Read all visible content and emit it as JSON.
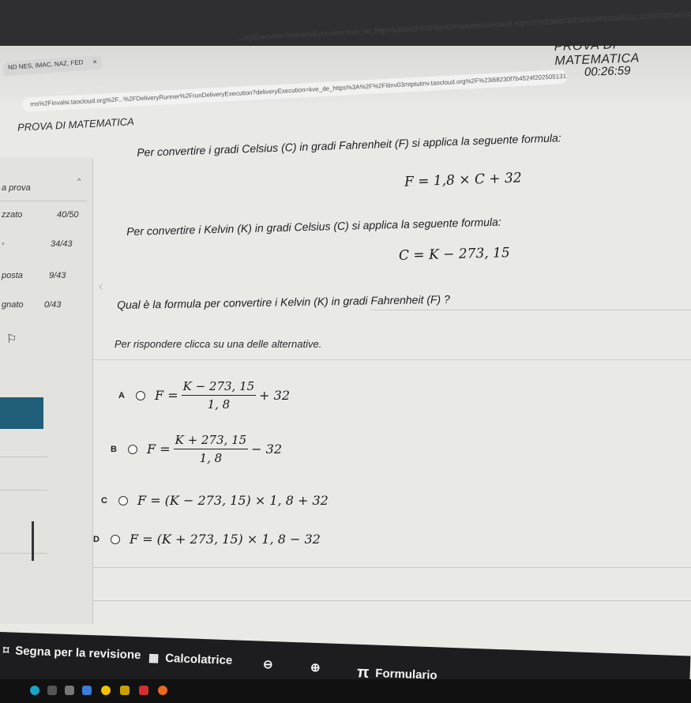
{
  "browser": {
    "tab_title": "ND NES, IMAC, NAZ, FED",
    "tab_close": "×",
    "url_text": "ms%2Finvalsi.taocloud.org%2F...%2FDeliveryRunner%2FrunDeliveryExecution?deliveryExecution=kve_de_https%3A%2F%2Fitinv03mtptutinv.taocloud.org%2F%23i68230f7b4524f2025051311230",
    "url_top": "...eryExecution?deliveryExecution=kve_de_https%3A%2F%2Fitinv03mtptutinv.taocloud.org%2F%23i68230f7b4524f202505131 12307d110eb14"
  },
  "header": {
    "title": "PROVA DI MATEMATICA",
    "timer": "00:26:59"
  },
  "sidebar": {
    "title": "PROVA DI MATEMATICA",
    "items": [
      {
        "label": "a prova",
        "value": ""
      },
      {
        "label": "zzato",
        "value": "40/50"
      },
      {
        "label": "",
        "value": "34/43"
      },
      {
        "label": "posta",
        "value": "9/43"
      },
      {
        "label": "gnato",
        "value": "0/43"
      }
    ]
  },
  "question": {
    "intro1": "Per convertire i gradi Celsius (C) in gradi Fahrenheit (F) si applica la seguente formula:",
    "formula1": "F = 1,8 × C + 32",
    "intro2": "Per convertire i Kelvin (K) in gradi Celsius (C) si applica la seguente formula:",
    "formula2": "C = K − 273, 15",
    "prompt": "Qual è la formula per convertire i Kelvin (K) in gradi Fahrenheit (F) ?",
    "instruction": "Per rispondere clicca su una delle alternative."
  },
  "options": {
    "a": {
      "letter": "A",
      "lhs": "F =",
      "num": "K − 273, 15",
      "den": "1, 8",
      "tail": "+ 32"
    },
    "b": {
      "letter": "B",
      "lhs": "F =",
      "num": "K + 273, 15",
      "den": "1, 8",
      "tail": "− 32"
    },
    "c": {
      "letter": "C",
      "text": "F = (K − 273, 15) × 1, 8 + 32"
    },
    "d": {
      "letter": "D",
      "text": "F = (K + 273, 15) × 1, 8 − 32"
    }
  },
  "toolbar": {
    "review": "Segna per la revisione",
    "calculator": "Calcolatrice",
    "zoom_out": "⊖",
    "zoom_in": "⊕",
    "formulary_symbol": "π",
    "formulary": "Formulario"
  },
  "colors": {
    "highlight": "#1f5d78",
    "toolbar_bg": "#1d1d1f"
  }
}
